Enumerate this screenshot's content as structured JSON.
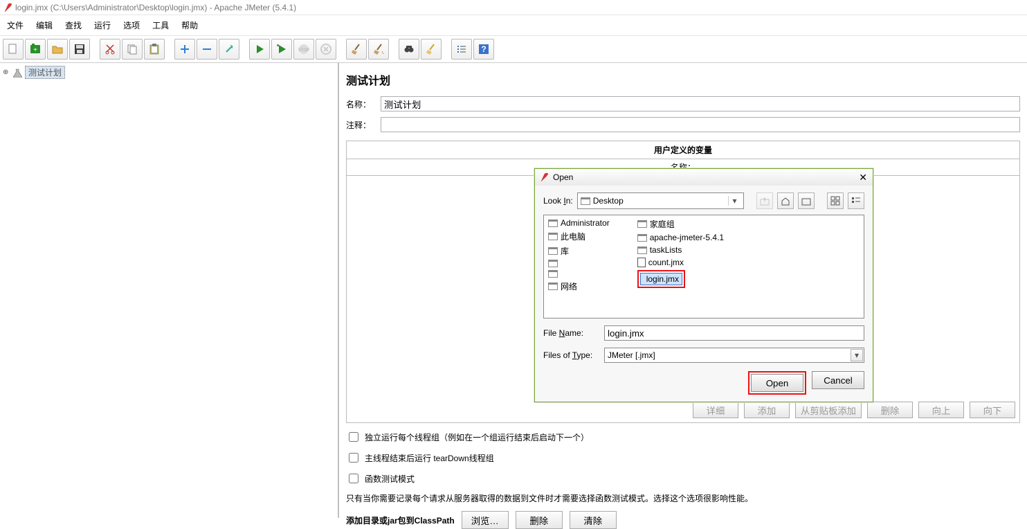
{
  "window": {
    "title": "login.jmx (C:\\Users\\Administrator\\Desktop\\login.jmx) - Apache JMeter (5.4.1)"
  },
  "menubar": {
    "file": "文件",
    "edit": "编辑",
    "search": "查找",
    "run": "运行",
    "options": "选项",
    "tools": "工具",
    "help": "帮助"
  },
  "tree": {
    "root": "测试计划"
  },
  "panel": {
    "title": "测试计划",
    "name_label": "名称：",
    "name_value": "测试计划",
    "comment_label": "注释：",
    "comment_value": "",
    "vars_title": "用户定义的变量",
    "vars_header": "名称：",
    "btns": {
      "detail": "详细",
      "add": "添加",
      "fromclip": "从剪贴板添加",
      "delete": "删除",
      "up": "向上",
      "down": "向下"
    },
    "chk1": "独立运行每个线程组（例如在一个组运行结束后启动下一个）",
    "chk2": "主线程结束后运行 tearDown线程组",
    "chk3": "函数测试模式",
    "hint": "只有当你需要记录每个请求从服务器取得的数据到文件时才需要选择函数测试模式。选择这个选项很影响性能。",
    "cp_label": "添加目录或jar包到ClassPath",
    "cp_browse": "浏览…",
    "cp_delete": "删除",
    "cp_clear": "清除"
  },
  "dialog": {
    "title": "Open",
    "lookin_label_pre": "Look ",
    "lookin_label_u": "I",
    "lookin_label_post": "n:",
    "lookin_value": "Desktop",
    "files_col1": [
      "Administrator",
      "此电脑",
      "库",
      "",
      "",
      "网络"
    ],
    "files_col2_folders": [
      "家庭组",
      "apache-jmeter-5.4.1",
      "taskLists"
    ],
    "files_col2_docs": [
      "count.jmx"
    ],
    "selected_file": "login.jmx",
    "filename_label_pre": "File ",
    "filename_label_u": "N",
    "filename_label_post": "ame:",
    "filename_value": "login.jmx",
    "filetype_label": "Files of ",
    "filetype_label_u": "T",
    "filetype_label_post": "ype:",
    "filetype_value": "JMeter [.jmx]",
    "open_btn": "Open",
    "cancel_btn": "Cancel"
  }
}
